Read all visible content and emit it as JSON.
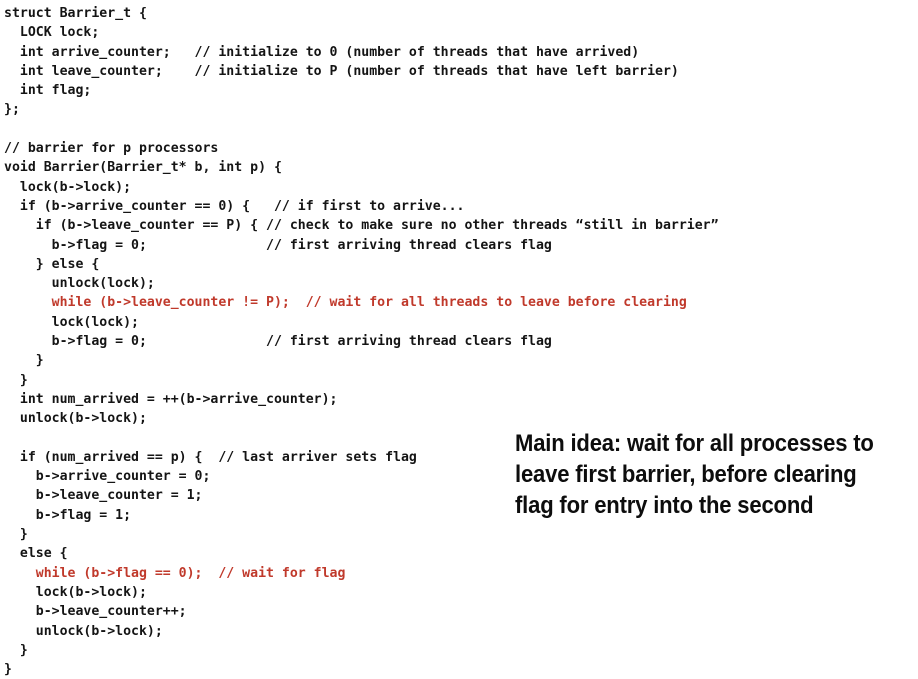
{
  "slide": {
    "background_color": "#ffffff",
    "code_color": "#141414",
    "highlight_color": "#C0392B",
    "callout_color": "#0d0d0d"
  },
  "code": {
    "language": "c",
    "lines": [
      {
        "text": "struct Barrier_t {",
        "color": "default"
      },
      {
        "text": "  LOCK lock;",
        "color": "default"
      },
      {
        "text": "  int arrive_counter;   // initialize to 0 (number of threads that have arrived)",
        "color": "default"
      },
      {
        "text": "  int leave_counter;    // initialize to P (number of threads that have left barrier)",
        "color": "default"
      },
      {
        "text": "  int flag;",
        "color": "default"
      },
      {
        "text": "};",
        "color": "default"
      },
      {
        "text": "",
        "color": "default"
      },
      {
        "text": "// barrier for p processors",
        "color": "default"
      },
      {
        "text": "void Barrier(Barrier_t* b, int p) {",
        "color": "default"
      },
      {
        "text": "  lock(b->lock);",
        "color": "default"
      },
      {
        "text": "  if (b->arrive_counter == 0) {   // if first to arrive...",
        "color": "default"
      },
      {
        "text": "    if (b->leave_counter == P) { // check to make sure no other threads “still in barrier”",
        "color": "default"
      },
      {
        "text": "      b->flag = 0;               // first arriving thread clears flag",
        "color": "default"
      },
      {
        "text": "    } else {",
        "color": "default"
      },
      {
        "text": "      unlock(lock);",
        "color": "default"
      },
      {
        "text": "      while (b->leave_counter != P);  // wait for all threads to leave before clearing",
        "color": "red"
      },
      {
        "text": "      lock(lock);",
        "color": "default"
      },
      {
        "text": "      b->flag = 0;               // first arriving thread clears flag",
        "color": "default"
      },
      {
        "text": "    }",
        "color": "default"
      },
      {
        "text": "  }",
        "color": "default"
      },
      {
        "text": "  int num_arrived = ++(b->arrive_counter);",
        "color": "default"
      },
      {
        "text": "  unlock(b->lock);",
        "color": "default"
      },
      {
        "text": "",
        "color": "default"
      },
      {
        "text": "  if (num_arrived == p) {  // last arriver sets flag",
        "color": "default"
      },
      {
        "text": "    b->arrive_counter = 0;",
        "color": "default"
      },
      {
        "text": "    b->leave_counter = 1;",
        "color": "default"
      },
      {
        "text": "    b->flag = 1;",
        "color": "default"
      },
      {
        "text": "  }",
        "color": "default"
      },
      {
        "text": "  else {",
        "color": "default"
      },
      {
        "text": "    while (b->flag == 0);  // wait for flag",
        "color": "red"
      },
      {
        "text": "    lock(b->lock);",
        "color": "default"
      },
      {
        "text": "    b->leave_counter++;",
        "color": "default"
      },
      {
        "text": "    unlock(b->lock);",
        "color": "default"
      },
      {
        "text": "  }",
        "color": "default"
      },
      {
        "text": "}",
        "color": "default"
      }
    ]
  },
  "callout": {
    "lines": [
      "Main idea: wait for all processes to",
      "leave first barrier, before clearing",
      "flag for entry into the second"
    ]
  }
}
